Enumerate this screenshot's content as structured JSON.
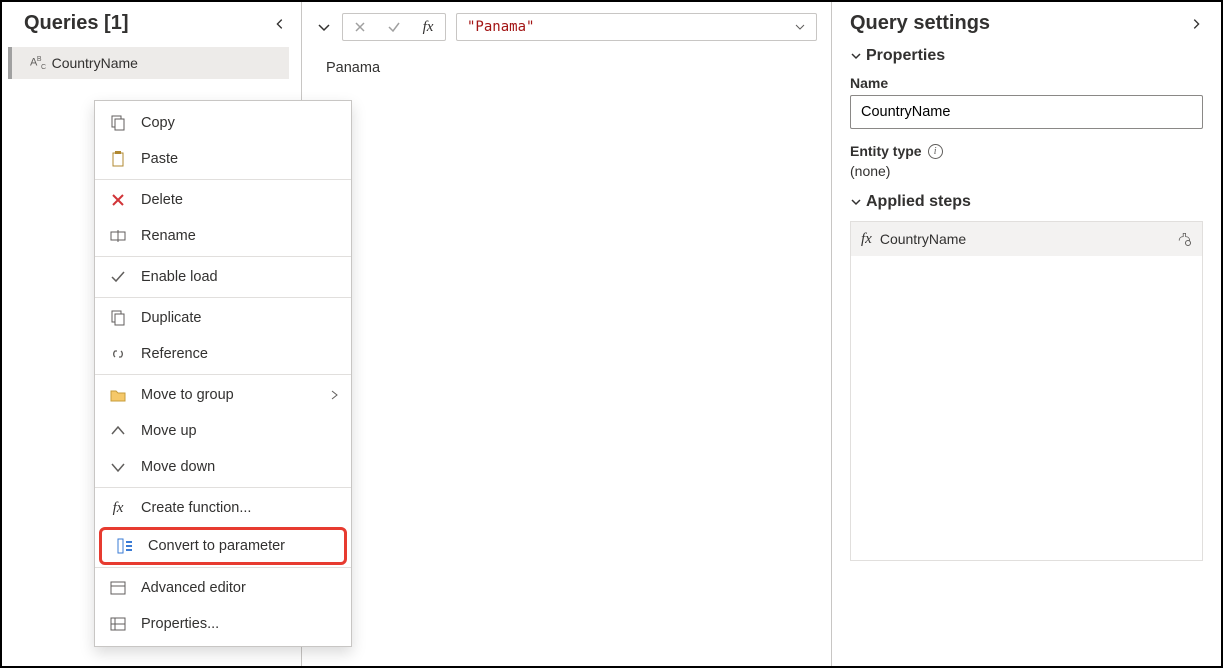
{
  "queries": {
    "title": "Queries [1]",
    "item_label": "CountryName"
  },
  "context_menu": {
    "copy": "Copy",
    "paste": "Paste",
    "delete": "Delete",
    "rename": "Rename",
    "enable_load": "Enable load",
    "duplicate": "Duplicate",
    "reference": "Reference",
    "move_to_group": "Move to group",
    "move_up": "Move up",
    "move_down": "Move down",
    "create_function": "Create function...",
    "convert_to_parameter": "Convert to parameter",
    "advanced_editor": "Advanced editor",
    "properties": "Properties..."
  },
  "formula": {
    "value": "\"Panama\""
  },
  "result": {
    "value": "Panama"
  },
  "settings": {
    "title": "Query settings",
    "properties_label": "Properties",
    "name_label": "Name",
    "name_value": "CountryName",
    "entity_type_label": "Entity type",
    "entity_type_value": "(none)",
    "applied_steps_label": "Applied steps",
    "step0": "CountryName"
  }
}
